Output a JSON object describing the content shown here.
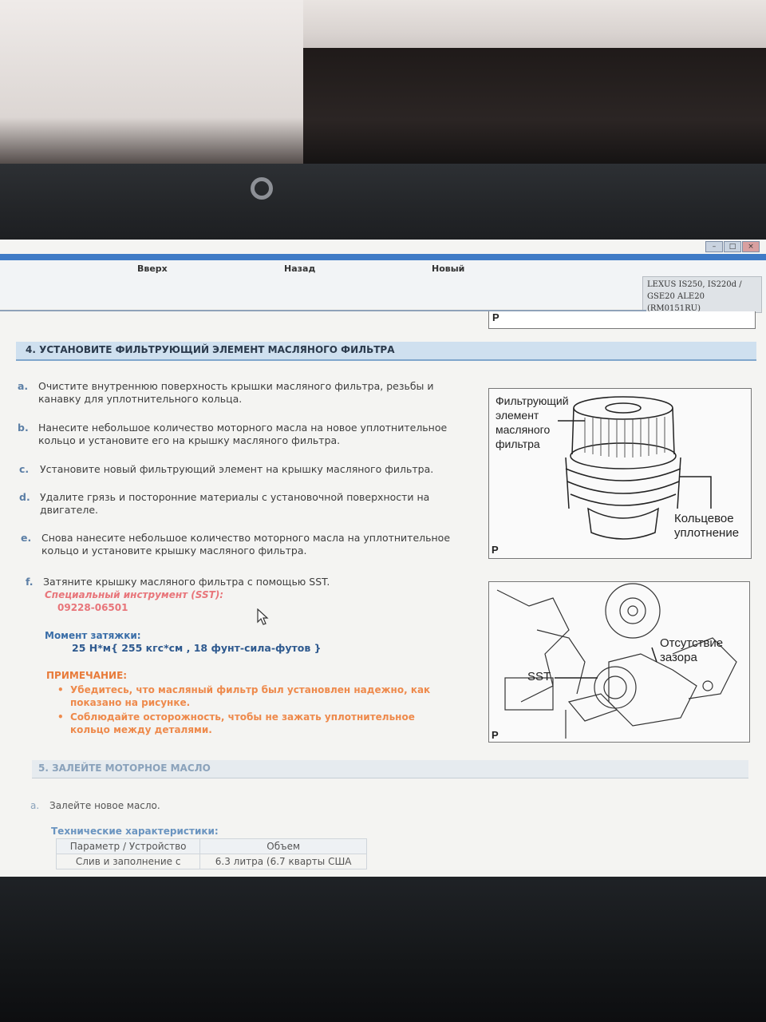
{
  "nav": {
    "up": "Вверх",
    "back": "Назад",
    "new": "Новый"
  },
  "model": {
    "line1": "LEXUS IS250, IS220d /",
    "line2": "GSE20 ALE20",
    "line3": "(RM0151RU)"
  },
  "section4": {
    "title": "4. УСТАНОВИТЕ ФИЛЬТРУЮЩИЙ ЭЛЕМЕНТ МАСЛЯНОГО ФИЛЬТРА",
    "steps": [
      {
        "letter": "a.",
        "line1": "Очистите внутреннюю поверхность крышки масляного фильтра, резьбы и",
        "line2": "канавку для уплотнительного кольца."
      },
      {
        "letter": "b.",
        "line1": "Нанесите небольшое количество моторного масла на новое уплотнительное",
        "line2": "кольцо и установите его на крышку масляного фильтра."
      },
      {
        "letter": "c.",
        "line1": "Установите новый фильтрующий элемент на крышку масляного фильтра.",
        "line2": ""
      },
      {
        "letter": "d.",
        "line1": "Удалите грязь и посторонние материалы с установочной поверхности на",
        "line2": "двигателе."
      },
      {
        "letter": "e.",
        "line1": "Снова нанесите небольшое количество моторного масла на уплотнительное",
        "line2": "кольцо и установите крышку масляного фильтра."
      },
      {
        "letter": "f.",
        "line1": "Затяните крышку масляного фильтра с помощью SST.",
        "line2": ""
      }
    ],
    "sst_label": "Специальный инструмент (SST):",
    "sst_code": "09228-06501",
    "torque_label": "Момент затяжки:",
    "torque_value": "25 Н*м{ 255 кгс*см , 18 фунт-сила-футов }",
    "note_label": "ПРИМЕЧАНИЕ:",
    "notes": [
      {
        "line1": "Убедитесь, что масляный фильтр был установлен надежно, как",
        "line2": "показано на рисунке."
      },
      {
        "line1": "Соблюдайте осторожность, чтобы не зажать уплотнительное",
        "line2": "кольцо между деталями."
      }
    ]
  },
  "figure1": {
    "label_element": [
      "Фильтрующий",
      "элемент",
      "масляного",
      "фильтра"
    ],
    "label_oring": [
      "Кольцевое",
      "уплотнение"
    ],
    "p": "P"
  },
  "figure2": {
    "label_gap": [
      "Отсутствие",
      "зазора"
    ],
    "label_sst": "SST",
    "p": "P"
  },
  "figure_prev_p": "P",
  "section5": {
    "title": "5. ЗАЛЕЙТЕ МОТОРНОЕ МАСЛО",
    "step_letter": "a.",
    "step_text": "Залейте новое масло.",
    "specs_label": "Технические характеристики:",
    "table_header": [
      "Параметр / Устройство",
      "Объем"
    ],
    "table_row": [
      "Слив и заполнение с",
      "6.3 литра (6.7 кварты США"
    ]
  }
}
